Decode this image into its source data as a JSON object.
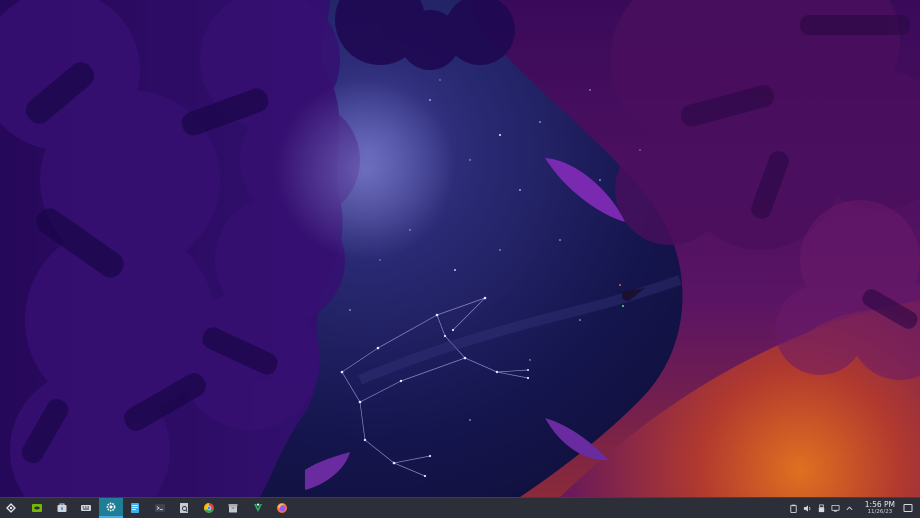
{
  "desktop": {
    "wallpaper": "night-sky-constellation",
    "colors": {
      "sky_center": "#2f2f78",
      "sky_dark": "#0d0b3a",
      "foliage_left": "#2a0e5e",
      "foliage_right": "#5a1060",
      "horizon_glow": "#c8561a",
      "moon": "#ffffff"
    }
  },
  "taskbar": {
    "launcher": {
      "icon": "app-launcher-icon"
    },
    "tasks": [
      {
        "icon": "nvidia-icon",
        "color": "#76b900",
        "active": false
      },
      {
        "icon": "discover-icon",
        "color": "#d0d4dc",
        "active": false
      },
      {
        "icon": "input-device-icon",
        "color": "#d0d4dc",
        "active": false
      },
      {
        "icon": "system-settings-icon",
        "color": "#ffffff",
        "active": true
      },
      {
        "icon": "text-editor-icon",
        "color": "#3daee9",
        "active": false
      },
      {
        "icon": "terminal-icon",
        "color": "#9aa0aa",
        "active": false
      },
      {
        "icon": "document-viewer-icon",
        "color": "#c9ccd3",
        "active": false
      },
      {
        "icon": "chrome-icon",
        "color": "#e94335",
        "active": false
      },
      {
        "icon": "archive-icon",
        "color": "#a7aab0",
        "active": false
      },
      {
        "icon": "vector-app-icon",
        "color": "#27ae60",
        "active": false
      },
      {
        "icon": "firefox-icon",
        "color": "#ff7139",
        "active": false
      }
    ],
    "tray": [
      {
        "icon": "clipboard-icon"
      },
      {
        "icon": "volume-icon"
      },
      {
        "icon": "usb-device-icon"
      },
      {
        "icon": "display-icon"
      },
      {
        "icon": "tray-expand-icon"
      }
    ],
    "clock": {
      "time": "1:56 PM",
      "date": "11/26/23"
    },
    "show_desktop": {
      "icon": "show-desktop-icon"
    },
    "colors": {
      "background": "#2c2f38",
      "active_task": "#1f7e95",
      "accent": "#3daee9"
    }
  }
}
